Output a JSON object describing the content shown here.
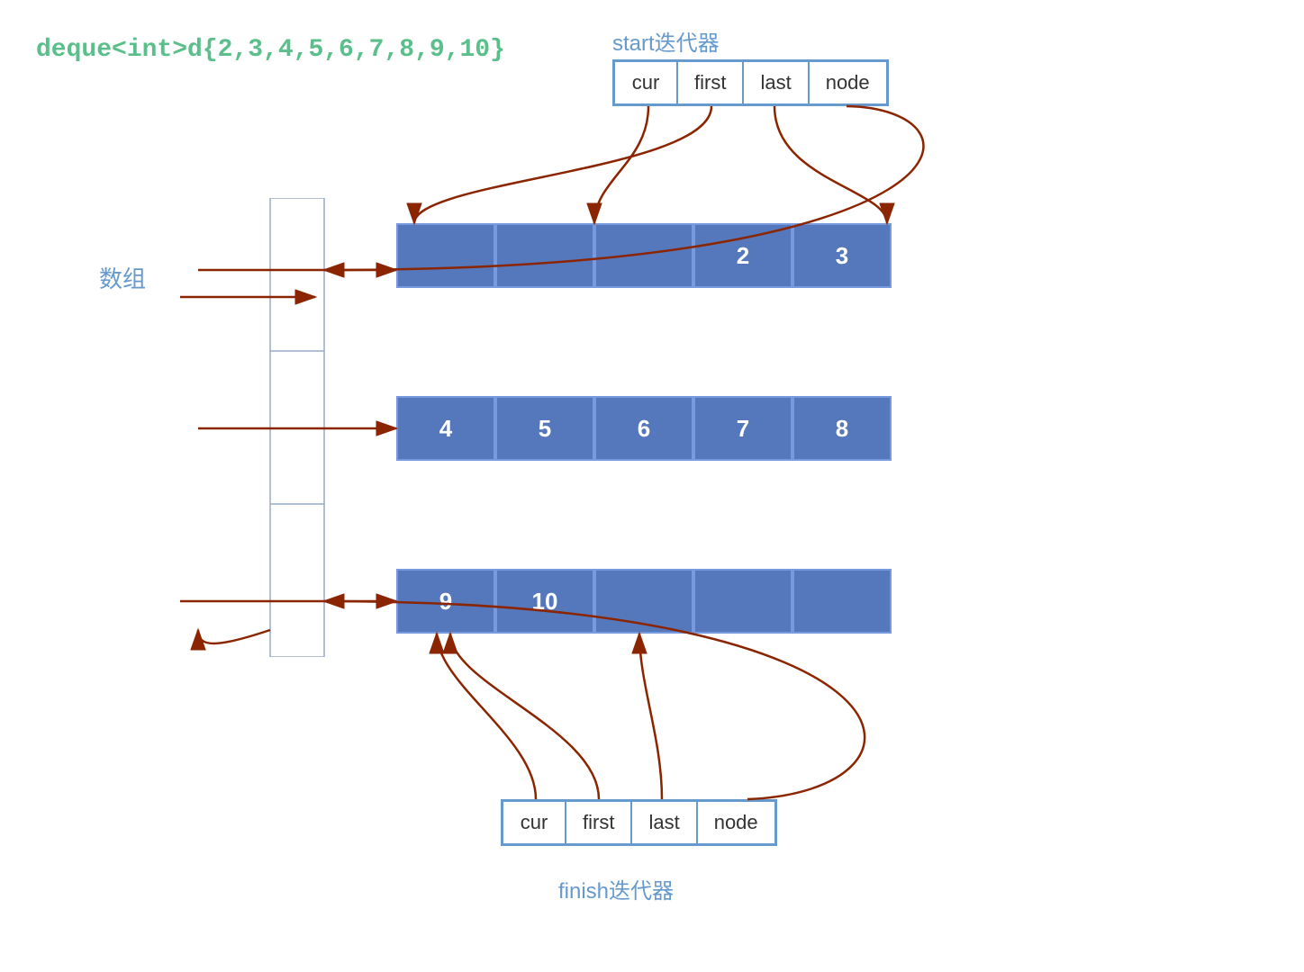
{
  "code_label": "deque<int>d{2,3,4,5,6,7,8,9,10}",
  "map_label": "数组",
  "start_label": "start迭代器",
  "finish_label": "finish迭代器",
  "start_iter": {
    "cells": [
      "cur",
      "first",
      "last",
      "node"
    ]
  },
  "finish_iter": {
    "cells": [
      "cur",
      "first",
      "last",
      "node"
    ]
  },
  "buffers": [
    {
      "values": [
        "",
        "",
        "",
        "2",
        "3"
      ]
    },
    {
      "values": [
        "4",
        "5",
        "6",
        "7",
        "8"
      ]
    },
    {
      "values": [
        "9",
        "10",
        "",
        "",
        ""
      ]
    }
  ]
}
